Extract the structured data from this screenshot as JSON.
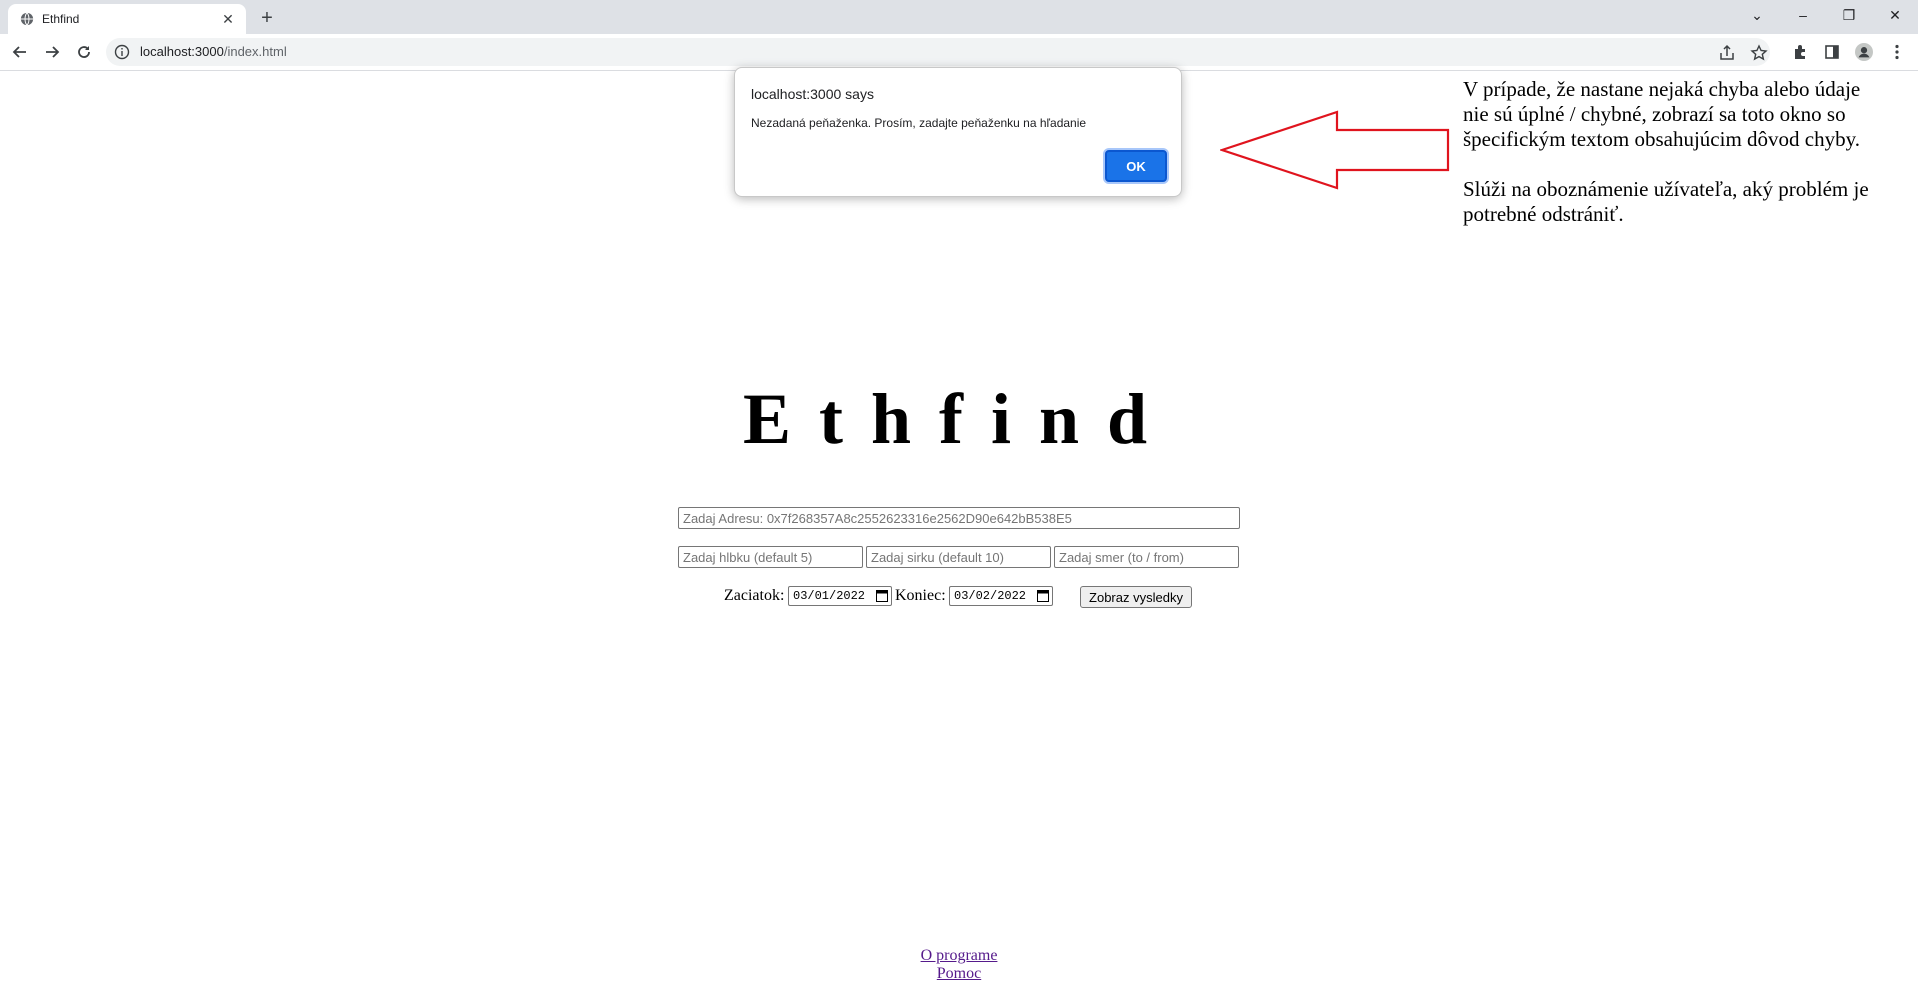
{
  "browser": {
    "tab_title": "Ethfind",
    "url_host": "localhost:3000",
    "url_path": "/index.html"
  },
  "page": {
    "title": "Ethfind",
    "address_placeholder": "Zadaj Adresu: 0x7f268357A8c2552623316e2562D90e642bB538E5",
    "depth_placeholder": "Zadaj hlbku (default 5)",
    "width_placeholder": "Zadaj sirku (default 10)",
    "direction_placeholder": "Zadaj smer (to / from)",
    "start_label": "Zaciatok:",
    "start_date": "03/01/2022",
    "end_label": "Koniec:",
    "end_date": "03/02/2022",
    "submit_label": "Zobraz vysledky",
    "footer_links": [
      "O programe",
      "Pomoc"
    ]
  },
  "dialog": {
    "title": "localhost:3000 says",
    "message": "Nezadaná peňaženka. Prosím, zadajte peňaženku na hľadanie",
    "ok_label": "OK"
  },
  "annotation": {
    "paragraph1": "V prípade, že nastane nejaká chyba alebo údaje nie sú úplné / chybné, zobrazí sa toto okno so špecifickým textom obsahujúcim dôvod chyby.",
    "paragraph2": "Slúži na oboznámenie užívateľa, aký problém je potrebné odstrániť.",
    "arrow_color": "#e0141e"
  },
  "icons": {
    "tab_favicon": "globe-icon",
    "info": "info-icon",
    "share": "share-icon",
    "bookmark": "star-icon",
    "extensions": "puzzle-icon",
    "side_panel": "side-panel-icon",
    "profile": "profile-icon",
    "menu": "kebab-menu-icon"
  },
  "colors": {
    "accent": "#1a73e8",
    "link_visited": "#551a8b"
  }
}
